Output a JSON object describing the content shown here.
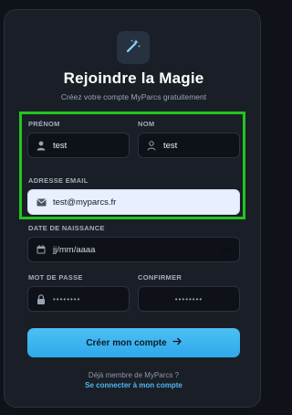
{
  "header": {
    "title": "Rejoindre la Magie",
    "subtitle": "Créez votre compte MyParcs gratuitement"
  },
  "form": {
    "prenom": {
      "label": "PRÉNOM",
      "value": "test"
    },
    "nom": {
      "label": "NOM",
      "value": "test"
    },
    "email": {
      "label": "ADRESSE EMAIL",
      "value": "test@myparcs.fr"
    },
    "birthdate": {
      "label": "DATE DE NAISSANCE",
      "value": "jj/mm/aaaa"
    },
    "password": {
      "label": "MOT DE PASSE",
      "value": "••••••••"
    },
    "confirm": {
      "label": "CONFIRMER",
      "value": "••••••••"
    },
    "submit_label": "Créer mon compte"
  },
  "footer": {
    "question": "Déjà membre de MyParcs ?",
    "login_link": "Se connecter à mon compte"
  },
  "colors": {
    "accent": "#39b1ee",
    "highlight": "#22c51f",
    "background": "#0f1219",
    "card": "#1a1f27"
  },
  "icons": {
    "logo": "magic-wand-icon",
    "prenom": "user-icon",
    "nom": "user-icon",
    "email": "envelope-icon",
    "birthdate": "calendar-icon",
    "password": "lock-icon",
    "submit": "arrow-right-icon"
  }
}
